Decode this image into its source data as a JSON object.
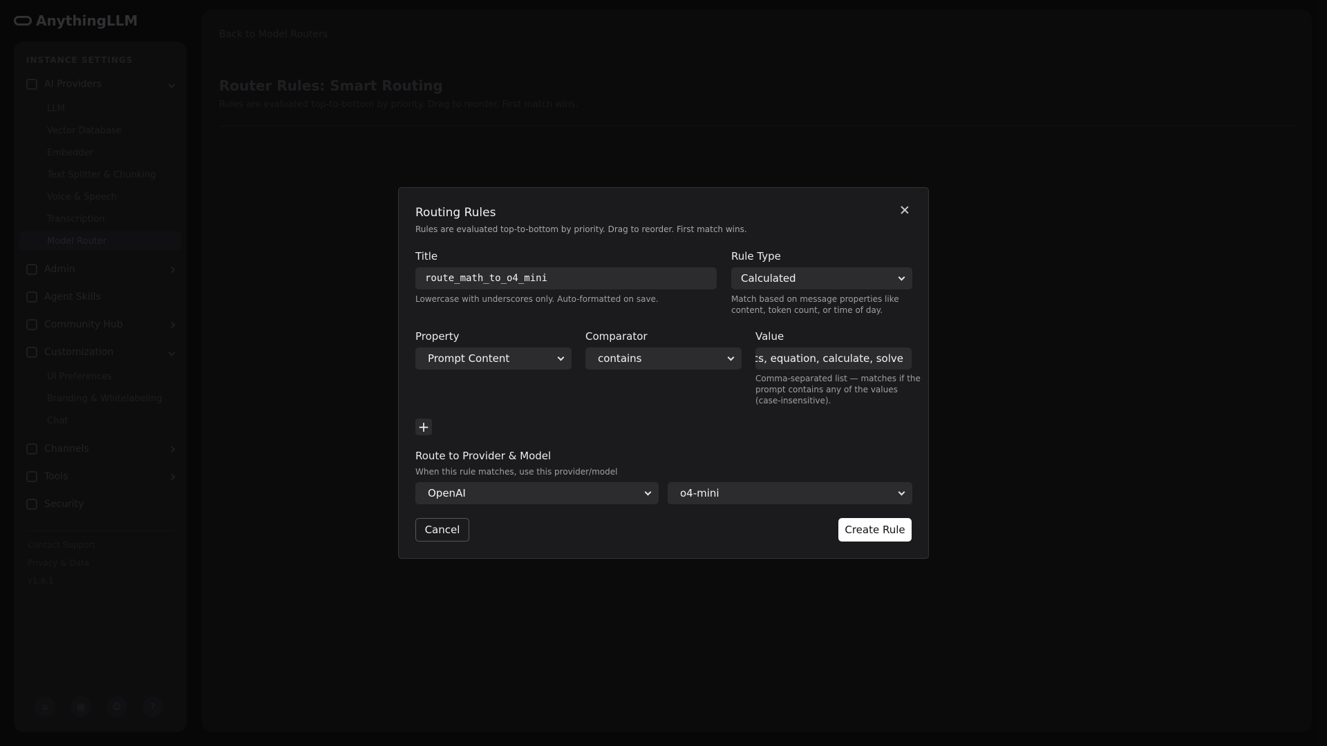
{
  "app": {
    "logo_text": "AnythingLLM",
    "sidebar": {
      "header": "INSTANCE SETTINGS",
      "items": [
        {
          "label": "AI Providers"
        },
        {
          "label": "Admin"
        },
        {
          "label": "Agent Skills"
        },
        {
          "label": "Community Hub"
        },
        {
          "label": "Customization"
        },
        {
          "label": "Channels"
        },
        {
          "label": "Tools"
        },
        {
          "label": "Security"
        }
      ],
      "ai_provider_subitems": [
        "LLM",
        "Vector Database",
        "Embedder",
        "Text Splitter & Chunking",
        "Voice & Speech",
        "Transcription",
        "Model Router"
      ],
      "customization_subitems": [
        "UI Preferences",
        "Branding & Whitelabeling",
        "Chat"
      ],
      "footer_links": [
        "Contact Support",
        "Privacy & Data",
        "v1.9.1"
      ]
    },
    "main": {
      "back_link": "Back to Model Routers",
      "title": "Router Rules: Smart Routing",
      "subtitle": "Rules are evaluated top-to-bottom by priority. Drag to reorder. First match wins."
    }
  },
  "modal": {
    "title": "Routing Rules",
    "description": "Rules are evaluated top-to-bottom by priority. Drag to reorder. First match wins.",
    "title_field": {
      "label": "Title",
      "value": "route_math_to_o4_mini",
      "help": "Lowercase with underscores only. Auto-formatted on save."
    },
    "rule_type": {
      "label": "Rule Type",
      "value": "Calculated",
      "help_line1": "Match based on message properties like",
      "help_line2": "content, token count, or time of day."
    },
    "condition": {
      "property_label": "Property",
      "property_value": "Prompt Content",
      "comparator_label": "Comparator",
      "comparator_value": "contains",
      "value_label": "Value",
      "value_value": "math, statistics, equation, calculate, solve",
      "value_help_line1": "Comma-separated list — matches if the",
      "value_help_line2": "prompt contains any of the values",
      "value_help_line3": "(case-insensitive)."
    },
    "add_condition": "+",
    "route": {
      "label": "Route to Provider & Model",
      "help": "When this rule matches, use this provider/model",
      "provider": "OpenAI",
      "model": "o4-mini"
    },
    "cancel_label": "Cancel",
    "create_label": "Create Rule"
  }
}
